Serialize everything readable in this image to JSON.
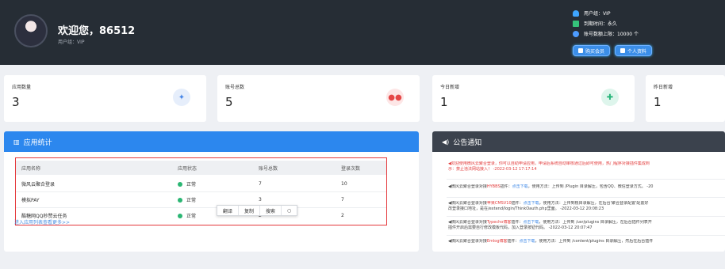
{
  "header": {
    "welcome": "欢迎您，86512",
    "subtitle": "用户组：VIP",
    "info": [
      {
        "icon": "user-icon",
        "text": "用户组：VIP"
      },
      {
        "icon": "calendar-icon",
        "text": "到期时间：永久"
      },
      {
        "icon": "limit-icon",
        "text": "账号数额上限：10000 个"
      }
    ],
    "buttons": {
      "buy": "购买会员",
      "profile": "个人资料"
    }
  },
  "stats": [
    {
      "label": "应用数量",
      "value": "3",
      "icon": "apps-icon"
    },
    {
      "label": "账号总数",
      "value": "5",
      "icon": "users-icon"
    },
    {
      "label": "今日新增",
      "value": "1",
      "icon": "calendar-plus-icon"
    },
    {
      "label": "昨日新增",
      "value": "1"
    }
  ],
  "app_stats": {
    "title": "应用统计",
    "columns": [
      "应用名称",
      "应用状态",
      "账号总数",
      "登录次数"
    ],
    "rows": [
      {
        "name": "微风云聚合登录",
        "status": "正常",
        "accounts": "7",
        "logins": "10"
      },
      {
        "name": "模拟PAY",
        "status": "正常",
        "accounts": "3",
        "logins": "7"
      },
      {
        "name": "酷糖网QQ秒赞云任务",
        "status": "正常",
        "accounts": "2",
        "logins": "2"
      }
    ],
    "more": "进入应用列表查看更多>>"
  },
  "context_menu": {
    "items": [
      "翻译",
      "复制",
      "搜索"
    ]
  },
  "notices": {
    "title": "公告通知",
    "items": [
      {
        "line1": "◀欢迎使用微风云聚合登录，你可以自助申请应用，申请后系统自动审核通过后即可使用，热门程序对接插件集成到",
        "line2": "示：禁止违法网站接入！ -2022-03-12 17:17:14"
      },
      {
        "prefix": "◀微风云聚合登录对接",
        "hl": "HYBBS",
        "mid": "插件：",
        "link": "点击下载",
        "rest": "，使用方法：上传到 /Plugin 目录解压，包含QQ、微信登录方式。 -20"
      },
      {
        "prefix": "◀微风云聚合登录对接",
        "hl": "苹果CMSV10",
        "mid": "插件：",
        "link": "点击下载",
        "rest": "，使用方法：上传到根目录解压，在后台'聚合登录配置'配置好",
        "line2": "改登录接口地址，是在/extend/login/ThinkOauth.php里面。 -2022-03-12 20:08:23"
      },
      {
        "prefix": "◀微风云聚合登录对接",
        "hl": "Typecho博客",
        "mid": "插件：",
        "link": "点击下载",
        "rest": "，使用方法：上传到 /usr/plugins 目录解压，在后台插件列表开",
        "line2": "插件开启后需要自行修改模板代码，加入登录按钮代码。 -2022-03-12 20:07:47"
      },
      {
        "prefix": "◀微风云聚合登录对接",
        "hl": "Emlog博客",
        "mid": "插件：",
        "link": "点击下载",
        "rest": "，使用方法：上传到 /content/plugins 目录解压，然后在后台插件"
      }
    ]
  }
}
